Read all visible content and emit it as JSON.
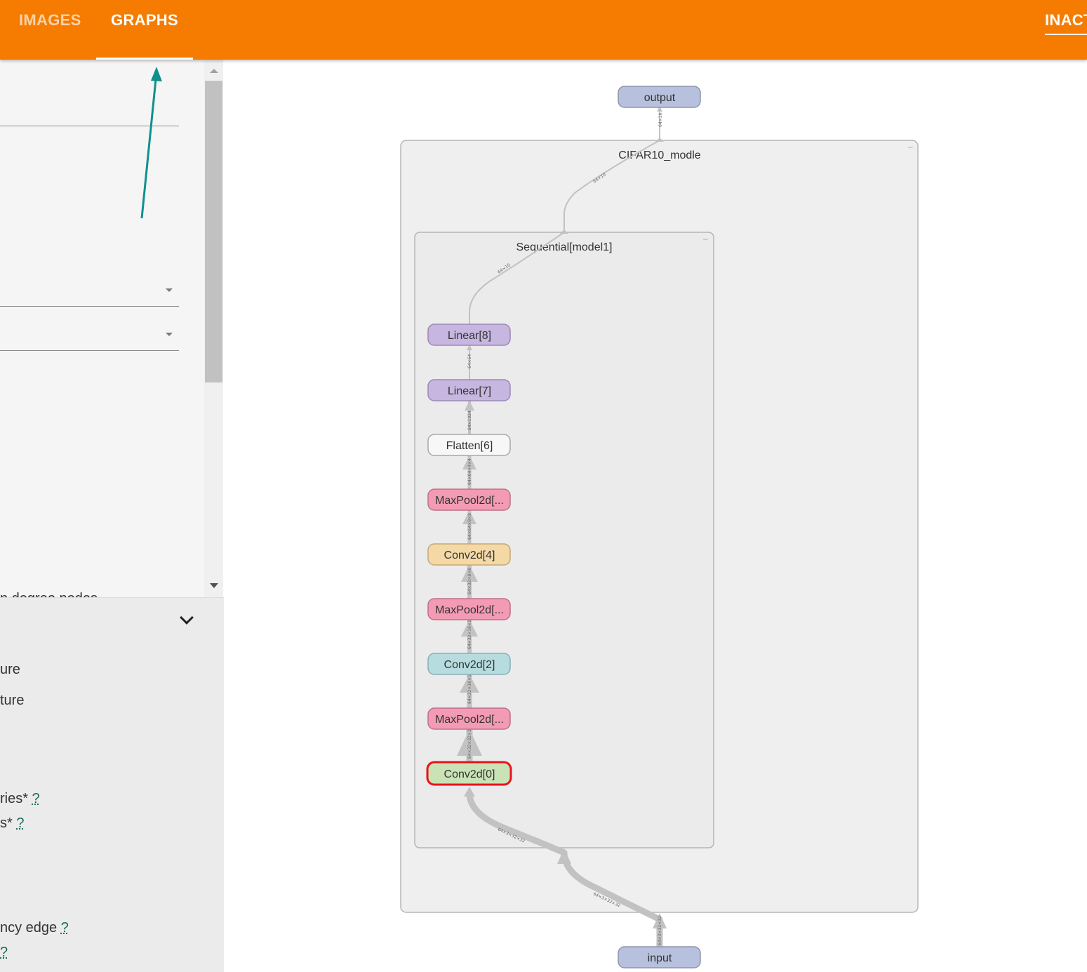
{
  "tabs": {
    "images": "IMAGES",
    "graphs": "GRAPHS",
    "inactive": "INACT"
  },
  "sidebar": {
    "cut_text": "n degree nodes",
    "options": [
      {
        "text": "ure"
      },
      {
        "text": "ture"
      },
      {
        "text": "ries*",
        "help": "?"
      },
      {
        "text": "s*",
        "help": "?"
      },
      {
        "text": "ncy edge",
        "help": "?"
      },
      {
        "text": "",
        "help": "?"
      }
    ]
  },
  "graph": {
    "groups": {
      "outer": "CIFAR10_modle",
      "inner": "Sequential[model1]"
    },
    "nodes": {
      "output": "output",
      "input": "input",
      "linear8": "Linear[8]",
      "linear7": "Linear[7]",
      "flatten6": "Flatten[6]",
      "maxpool5": "MaxPool2d[...",
      "conv4": "Conv2d[4]",
      "maxpool3": "MaxPool2d[...",
      "conv2": "Conv2d[2]",
      "maxpool1": "MaxPool2d[...",
      "conv0": "Conv2d[0]"
    },
    "edge_labels": {
      "e_out": "64×10",
      "e_seq_out": "64×10",
      "e_lin8": "64×10",
      "e_7_8": "64×64",
      "e_6_7": "64×1024",
      "e_5_6": "64×64×4×4",
      "e_4_5": "64×64×8×8",
      "e_3_4": "64×32×8×8",
      "e_2_3": "64×32×16×16",
      "e_1_2": "64×32×16×16",
      "e_0_1": "64×32×32×32",
      "e_in_0": "64×3×32×32",
      "e_in_seq": "64×3×32×32",
      "e_in": "64×3×32×32"
    },
    "colors": {
      "io": "#b7c0dc",
      "linear": "#c6b6e0",
      "flatten": "#f7f7f7",
      "maxpool": "#f39bb5",
      "conv4": "#f4d9a6",
      "conv2": "#b7dce0",
      "conv0": "#c9e3b6",
      "selected_border": "#e8121c"
    }
  }
}
